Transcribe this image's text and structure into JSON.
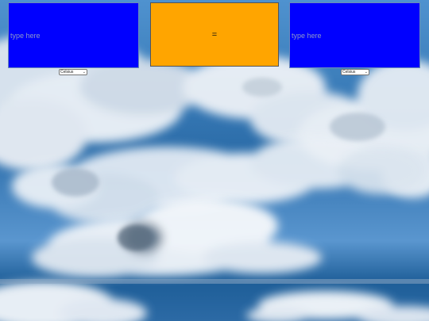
{
  "converter": {
    "left_input": {
      "placeholder": "type here",
      "value": ""
    },
    "equals_sign": "=",
    "right_input": {
      "placeholder": "type here",
      "value": ""
    },
    "left_unit": {
      "selected": "Celsius",
      "icon": "chevron-down-icon"
    },
    "right_unit": {
      "selected": "Celsius",
      "icon": "chevron-down-icon"
    }
  },
  "colors": {
    "input_background": "#0000ff",
    "equals_background": "#ffa500",
    "sky_background": "#3f7fbf"
  }
}
